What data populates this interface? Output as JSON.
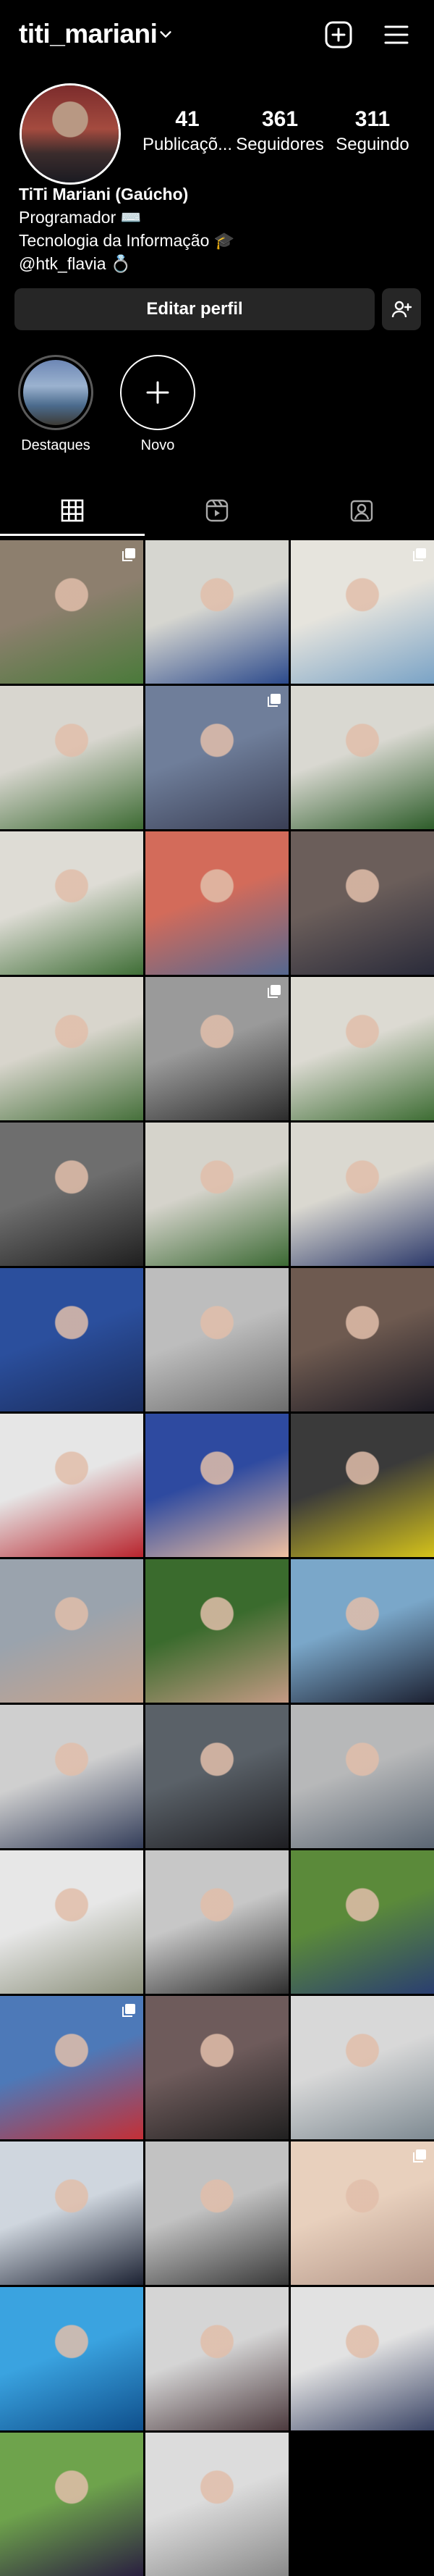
{
  "header": {
    "username": "titi_mariani",
    "icons": [
      "chevron-down-icon",
      "plus-square-icon",
      "menu-icon"
    ]
  },
  "profile": {
    "stats": [
      {
        "value": "41",
        "label": "Publicaçõ..."
      },
      {
        "value": "361",
        "label": "Seguidores"
      },
      {
        "value": "311",
        "label": "Seguindo"
      }
    ],
    "bio": {
      "name": "TiTi Mariani (Gaúcho)",
      "line1": "Programador ⌨️",
      "line2": "Tecnologia da Informação 🎓",
      "line3": "@htk_flavia 💍"
    },
    "edit_button": "Editar perfil"
  },
  "highlights": [
    {
      "label": "Destaques"
    },
    {
      "label": "Novo"
    }
  ],
  "tabs": [
    "grid-icon",
    "reels-icon",
    "tagged-icon"
  ],
  "colors": {
    "background": "#000000",
    "button": "#262626",
    "text": "#ffffff"
  },
  "posts": [
    {
      "c1": "#8d7f6e",
      "c2": "#4a7a3a",
      "multi": true
    },
    {
      "c1": "#d6d6d0",
      "c2": "#2c4a8c",
      "multi": false
    },
    {
      "c1": "#e6e4dd",
      "c2": "#7aa3c6",
      "multi": true
    },
    {
      "c1": "#d8d6cf",
      "c2": "#3d6b33",
      "multi": false
    },
    {
      "c1": "#6f7e9a",
      "c2": "#3a3f55",
      "multi": true
    },
    {
      "c1": "#d9d8d1",
      "c2": "#2e5d2a",
      "multi": false
    },
    {
      "c1": "#dedcd5",
      "c2": "#3f6e36",
      "multi": false
    },
    {
      "c1": "#d36b5a",
      "c2": "#556890",
      "multi": false
    },
    {
      "c1": "#6b5e5a",
      "c2": "#2a2b3a",
      "multi": false
    },
    {
      "c1": "#d8d5cc",
      "c2": "#46703b",
      "multi": false
    },
    {
      "c1": "#9a9a9a",
      "c2": "#2c2c2c",
      "multi": true
    },
    {
      "c1": "#dcdad2",
      "c2": "#3e6d34",
      "multi": false
    },
    {
      "c1": "#6e6e6e",
      "c2": "#1f1f1f",
      "multi": false
    },
    {
      "c1": "#d5d3cb",
      "c2": "#3b6933",
      "multi": false
    },
    {
      "c1": "#dad8d0",
      "c2": "#2d3a6b",
      "multi": false
    },
    {
      "c1": "#2b4f9d",
      "c2": "#1a2c5c",
      "multi": false
    },
    {
      "c1": "#bdbdbd",
      "c2": "#6d6d6d",
      "multi": false
    },
    {
      "c1": "#6e5a50",
      "c2": "#1d1b24",
      "multi": false
    },
    {
      "c1": "#e6e6e6",
      "c2": "#b8242d",
      "multi": false
    },
    {
      "c1": "#2e4aa0",
      "c2": "#f0c0a0",
      "multi": false
    },
    {
      "c1": "#3a3a3a",
      "c2": "#d4c21a",
      "multi": false
    },
    {
      "c1": "#9aa3ad",
      "c2": "#c8a38c",
      "multi": false
    },
    {
      "c1": "#3a6b2d",
      "c2": "#c49a84",
      "multi": false
    },
    {
      "c1": "#7aa7c9",
      "c2": "#1d2233",
      "multi": false
    },
    {
      "c1": "#cfcfcf",
      "c2": "#343e5a",
      "multi": false
    },
    {
      "c1": "#5a6168",
      "c2": "#1e1e22",
      "multi": false
    },
    {
      "c1": "#b7b8b9",
      "c2": "#5b6673",
      "multi": false
    },
    {
      "c1": "#e7e7e7",
      "c2": "#8a8f7a",
      "multi": false
    },
    {
      "c1": "#c7c7c7",
      "c2": "#2e2e2e",
      "multi": false
    },
    {
      "c1": "#5b8a3a",
      "c2": "#2a3e70",
      "multi": false
    },
    {
      "c1": "#4d79b8",
      "c2": "#c42f36",
      "multi": true
    },
    {
      "c1": "#6e5b5b",
      "c2": "#202020",
      "multi": false
    },
    {
      "c1": "#d8d8d8",
      "c2": "#7e8a92",
      "multi": false
    },
    {
      "c1": "#cfd6de",
      "c2": "#1c2233",
      "multi": false
    },
    {
      "c1": "#c2c2c2",
      "c2": "#383838",
      "multi": false
    },
    {
      "c1": "#e8d0bd",
      "c2": "#b5988a",
      "multi": true
    },
    {
      "c1": "#3aa3e0",
      "c2": "#0f4f8c",
      "multi": false
    },
    {
      "c1": "#d5d5d5",
      "c2": "#4c3a3e",
      "multi": false
    },
    {
      "c1": "#e2e2e2",
      "c2": "#3b4566",
      "multi": false
    },
    {
      "c1": "#6ea34c",
      "c2": "#2a1f40",
      "multi": false
    },
    {
      "c1": "#dcdcdc",
      "c2": "#8a8a8a",
      "multi": false
    }
  ]
}
